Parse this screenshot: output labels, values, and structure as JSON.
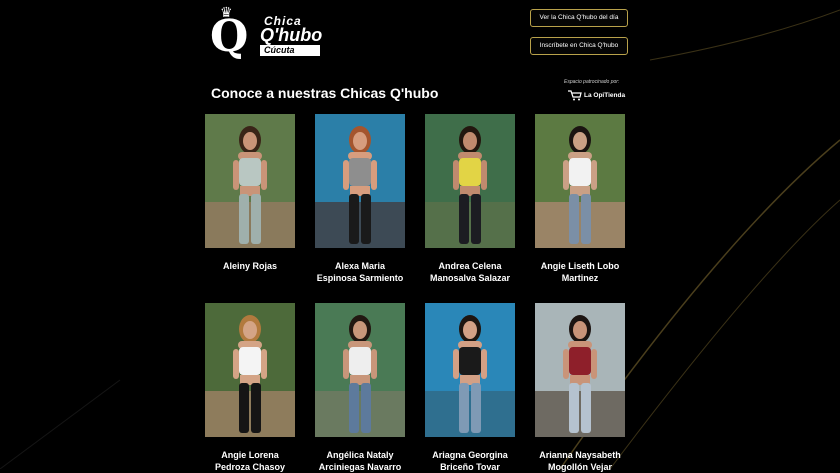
{
  "brand": {
    "logo_chica": "Chica",
    "logo_qhubo": "Q'hubo",
    "logo_city": "Cúcuta"
  },
  "header": {
    "button_today": "Ver la Chica Q'hubo del día",
    "button_signup": "Inscríbete en Chica Q'hubo"
  },
  "section": {
    "title": "Conoce a nuestras Chicas Q'hubo",
    "sponsor_label": "Espacio patrocinado por:",
    "sponsor_name": "La OpiTienda"
  },
  "gallery": [
    {
      "name": "Aleiny Rojas",
      "colors": {
        "bg": "#5f7a4a",
        "ground": "#8a7a5c",
        "skin": "#c99478",
        "hair": "#3a2518",
        "top": "#b9c7c2",
        "bottom": "#9fb0ac"
      }
    },
    {
      "name": "Alexa Maria Espinosa Sarmiento",
      "colors": {
        "bg": "#2b7fa8",
        "ground": "#3d4a55",
        "skin": "#d79d7e",
        "hair": "#a4552e",
        "top": "#8e8e8e",
        "bottom": "#1a1a1a"
      }
    },
    {
      "name": "Andrea Celena Manosalva Salazar",
      "colors": {
        "bg": "#3f6e4a",
        "ground": "#55704a",
        "skin": "#c08a6e",
        "hair": "#23170f",
        "top": "#e2d445",
        "bottom": "#1c1c22"
      }
    },
    {
      "name": "Angie Liseth Lobo Martinez",
      "colors": {
        "bg": "#5c7a42",
        "ground": "#9a8466",
        "skin": "#caa085",
        "hair": "#1b1411",
        "top": "#f2f2f2",
        "bottom": "#7b8fa6"
      }
    },
    {
      "name": "Angie Lorena Pedroza Chasoy",
      "colors": {
        "bg": "#4d6a3a",
        "ground": "#8e7c5c",
        "skin": "#d4a486",
        "hair": "#b27a3e",
        "top": "#f4f4f4",
        "bottom": "#151515"
      }
    },
    {
      "name": "Angélica Nataly Arciniegas Navarro",
      "colors": {
        "bg": "#4a7a55",
        "ground": "#6a7a60",
        "skin": "#c8967a",
        "hair": "#221711",
        "top": "#eeeeee",
        "bottom": "#5d7a9c"
      }
    },
    {
      "name": "Ariagna Georgina Briceño Tovar",
      "colors": {
        "bg": "#2a87b8",
        "ground": "#2f6f8f",
        "skin": "#d3a085",
        "hair": "#1e1510",
        "top": "#1a1a1a",
        "bottom": "#7f9ab5"
      }
    },
    {
      "name": "Arianna Naysabeth Mogollón Vejar",
      "colors": {
        "bg": "#a9b5b8",
        "ground": "#6e6a62",
        "skin": "#c99479",
        "hair": "#1d1512",
        "top": "#8e1f2a",
        "bottom": "#b5c2cf"
      }
    }
  ]
}
